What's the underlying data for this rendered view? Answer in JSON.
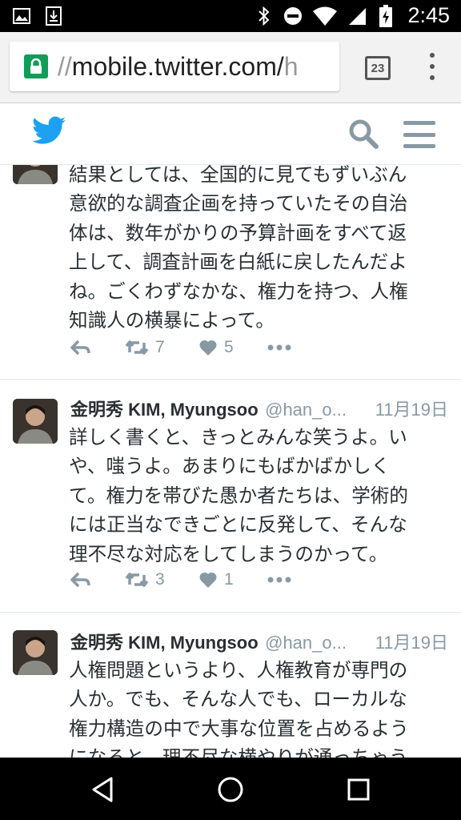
{
  "status_bar": {
    "time": "2:45",
    "left_icons": [
      "image-notification-icon",
      "download-notification-icon"
    ],
    "right_icons": [
      "bluetooth-icon",
      "do-not-disturb-icon",
      "wifi-icon",
      "cell-signal-icon",
      "battery-charging-icon"
    ]
  },
  "browser": {
    "url_scheme": "//",
    "url_host": "mobile.twitter.com/",
    "url_rest": "h",
    "tab_count": "23"
  },
  "timeline": {
    "tweets": [
      {
        "text_lines": [
          "結果としては、全国的に見てもずいぶん",
          "意欲的な調査企画を持っていたその自治",
          "体は、数年がかりの予算計画をすべて返",
          "上して、調査計画を白紙に戻したんだよ",
          "ね。ごくわずなかな、権力を持つ、人権",
          "知識人の横暴によって。"
        ],
        "retweets": "7",
        "likes": "5"
      },
      {
        "name": "金明秀 KIM, Myungsoo",
        "handle": "@han_o...",
        "time": "11月19日",
        "text_lines": [
          "詳しく書くと、きっとみんな笑うよ。い",
          "や、嗤うよ。あまりにもばかばかしく",
          "て。権力を帯びた愚か者たちは、学術的",
          "には正当なできごとに反発して、そんな",
          "理不尽な対応をしてしまうのかって。"
        ],
        "retweets": "3",
        "likes": "1"
      },
      {
        "name": "金明秀 KIM, Myungsoo",
        "handle": "@han_o...",
        "time": "11月19日",
        "text_lines": [
          "人権問題というより、人権教育が専門の",
          "人か。でも、そんな人でも、ローカルな",
          "権力構造の中で大事な位置を占めるよう",
          "になると、理不尽な横やりが通っちゃう"
        ]
      }
    ]
  }
}
